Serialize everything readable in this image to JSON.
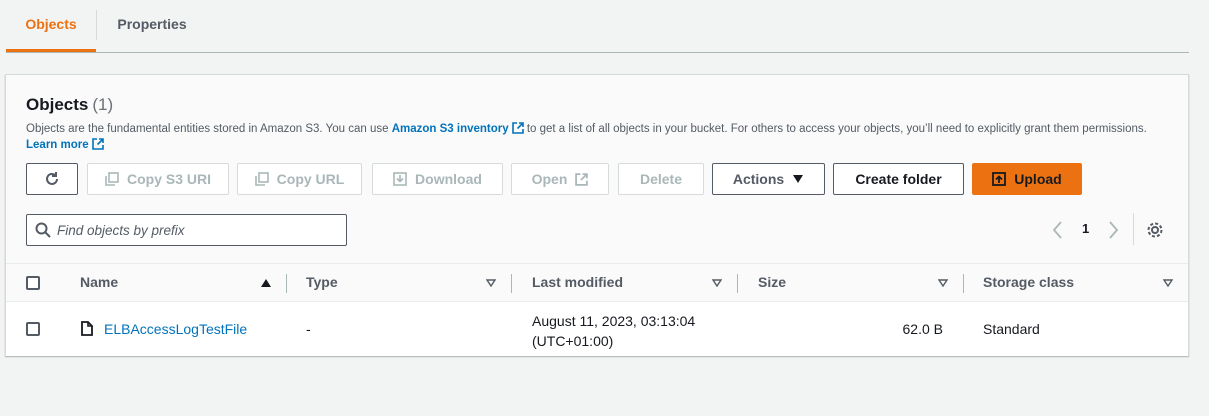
{
  "tabs": [
    {
      "label": "Objects",
      "active": true
    },
    {
      "label": "Properties",
      "active": false
    }
  ],
  "panel": {
    "title": "Objects",
    "count": "(1)",
    "description": {
      "part1": "Objects are the fundamental entities stored in Amazon S3. You can use ",
      "inventory_link": "Amazon S3 inventory",
      "part2": " to get a list of all objects in your bucket. For others to access your objects, you’ll need to explicitly grant them permissions. ",
      "learn_more": "Learn more"
    }
  },
  "toolbar": {
    "copy_s3_uri": "Copy S3 URI",
    "copy_url": "Copy URL",
    "download": "Download",
    "open": "Open",
    "delete": "Delete",
    "actions": "Actions",
    "create_folder": "Create folder",
    "upload": "Upload"
  },
  "search": {
    "placeholder": "Find objects by prefix",
    "value": ""
  },
  "pagination": {
    "current_page": "1"
  },
  "table": {
    "columns": [
      "Name",
      "Type",
      "Last modified",
      "Size",
      "Storage class"
    ],
    "rows": [
      {
        "name": "ELBAccessLogTestFile",
        "type": "-",
        "last_modified_line1": "August 11, 2023, 03:13:04",
        "last_modified_line2": "(UTC+01:00)",
        "size": "62.0 B",
        "storage_class": "Standard"
      }
    ]
  },
  "colors": {
    "accent": "#ec7211",
    "link": "#0073bb",
    "text": "#16191f",
    "muted": "#545b64"
  }
}
